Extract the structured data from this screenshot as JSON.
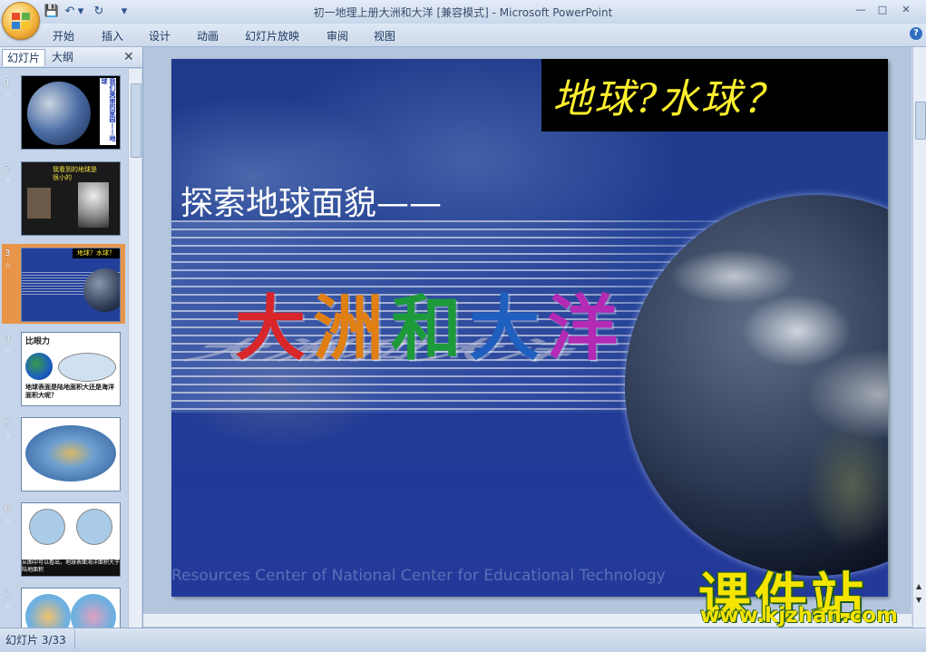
{
  "window": {
    "title": "初一地理上册大洲和大洋 [兼容模式] - Microsoft PowerPoint",
    "controls": [
      "—",
      "□",
      "✕"
    ]
  },
  "quick_access": [
    "💾",
    "↶",
    "▾",
    "↻",
    "▾"
  ],
  "ribbon": {
    "tabs": [
      "开始",
      "插入",
      "设计",
      "动画",
      "幻灯片放映",
      "审阅",
      "视图"
    ],
    "help": "?"
  },
  "panel": {
    "tabs": [
      "幻灯片",
      "大纲"
    ],
    "close": "✕",
    "thumbnails": [
      {
        "num": "1",
        "text": "我们美丽的家园——地球"
      },
      {
        "num": "2",
        "text": "我看到的地球是很小的"
      },
      {
        "num": "3",
        "text": "地球？水球？",
        "selected": true
      },
      {
        "num": "4",
        "text": "地球表面是陆地面积大还是海洋面积大呢？",
        "heading": "比眼力"
      },
      {
        "num": "5",
        "text": ""
      },
      {
        "num": "6",
        "text": "从图中可以看出，地球表面海洋面积大于陆地面积"
      },
      {
        "num": "7",
        "text": ""
      }
    ]
  },
  "slide": {
    "title": "地球?水球？",
    "subtitle": "探索地球面貌——",
    "big_title": [
      "大",
      "洲",
      "和",
      "大",
      "洋"
    ],
    "big_title_colors": [
      "#d8262a",
      "#e07f14",
      "#1d9a3a",
      "#1e5fbf",
      "#b32ab5"
    ],
    "watermark": "Resources Center of National Center for Educational Technology"
  },
  "watermark_overlay": {
    "logo": "课件站",
    "url": "www.kjzhan.com"
  },
  "status": {
    "slide_indicator": "幻灯片 3/33"
  }
}
